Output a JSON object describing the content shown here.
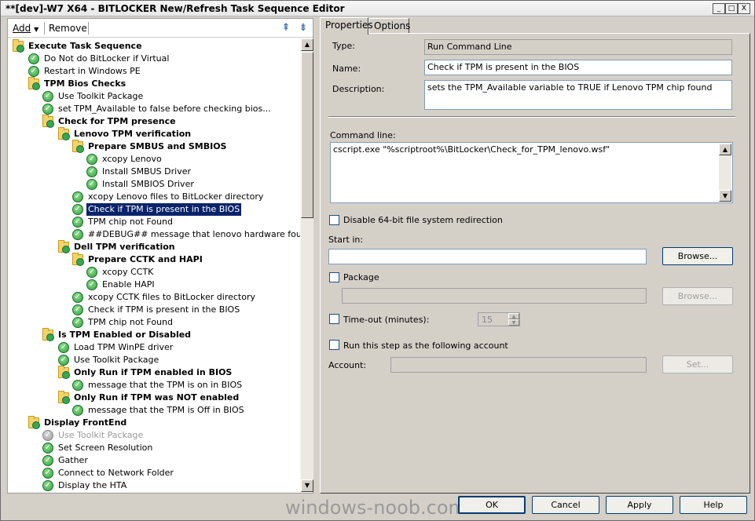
{
  "window": {
    "title": "**[dev]-W7 X64 - BITLOCKER New/Refresh Task Sequence Editor",
    "caption_buttons": [
      "_",
      "□",
      "X"
    ]
  },
  "toolbar": {
    "add_label": "Add",
    "remove_label": "Remove",
    "icons": [
      "move-up-icon",
      "move-down-icon"
    ]
  },
  "tree": {
    "items": [
      {
        "label": "Execute Task Sequence",
        "type": "group",
        "level": 0
      },
      {
        "label": "Do Not do BitLocker if Virtual",
        "type": "step",
        "level": 1
      },
      {
        "label": "Restart in Windows PE",
        "type": "step",
        "level": 1
      },
      {
        "label": "TPM Bios Checks",
        "type": "group",
        "level": 1
      },
      {
        "label": "Use Toolkit Package",
        "type": "step",
        "level": 2
      },
      {
        "label": "set TPM_Available to false before checking bios...",
        "type": "step",
        "level": 2
      },
      {
        "label": "Check for TPM presence",
        "type": "group",
        "level": 2
      },
      {
        "label": "Lenovo TPM verification",
        "type": "group",
        "level": 3
      },
      {
        "label": "Prepare SMBUS and SMBIOS",
        "type": "group",
        "level": 4
      },
      {
        "label": "xcopy Lenovo",
        "type": "step",
        "level": 5
      },
      {
        "label": "Install SMBUS Driver",
        "type": "step",
        "level": 5
      },
      {
        "label": "Install SMBIOS Driver",
        "type": "step",
        "level": 5
      },
      {
        "label": "xcopy Lenovo files to BitLocker directory",
        "type": "step",
        "level": 4
      },
      {
        "label": "Check if TPM is present in the BIOS",
        "type": "step",
        "level": 4,
        "selected": true
      },
      {
        "label": "TPM chip not Found",
        "type": "step",
        "level": 4
      },
      {
        "label": "##DEBUG## message that lenovo hardware found",
        "type": "step",
        "level": 4
      },
      {
        "label": "Dell TPM verification",
        "type": "group",
        "level": 3
      },
      {
        "label": "Prepare CCTK and HAPI",
        "type": "group",
        "level": 4
      },
      {
        "label": "xcopy CCTK",
        "type": "step",
        "level": 5
      },
      {
        "label": "Enable HAPI",
        "type": "step",
        "level": 5
      },
      {
        "label": "xcopy CCTK files to BitLocker directory",
        "type": "step",
        "level": 4
      },
      {
        "label": "Check if TPM is present in the BIOS",
        "type": "step",
        "level": 4
      },
      {
        "label": "TPM chip not Found",
        "type": "step",
        "level": 4
      },
      {
        "label": "Is TPM Enabled or Disabled",
        "type": "group",
        "level": 2
      },
      {
        "label": "Load TPM WinPE driver",
        "type": "step",
        "level": 3
      },
      {
        "label": "Use Toolkit Package",
        "type": "step",
        "level": 3
      },
      {
        "label": "Only Run if TPM enabled in BIOS",
        "type": "group",
        "level": 3
      },
      {
        "label": "message that the  TPM is on in BIOS",
        "type": "step",
        "level": 4
      },
      {
        "label": "Only Run if TPM was NOT enabled",
        "type": "group",
        "level": 3
      },
      {
        "label": "message that the  TPM is Off in BIOS",
        "type": "step",
        "level": 4
      },
      {
        "label": "Display FrontEnd",
        "type": "group",
        "level": 1
      },
      {
        "label": "Use Toolkit Package",
        "type": "step",
        "level": 2,
        "disabled": true
      },
      {
        "label": "Set Screen Resolution",
        "type": "step",
        "level": 2
      },
      {
        "label": "Gather",
        "type": "step",
        "level": 2
      },
      {
        "label": "Connect to Network Folder",
        "type": "step",
        "level": 2
      },
      {
        "label": "Display the HTA",
        "type": "step",
        "level": 2
      }
    ]
  },
  "tabs": [
    {
      "label": "Properties",
      "active": true
    },
    {
      "label": "Options",
      "active": false
    }
  ],
  "properties": {
    "type_label": "Type:",
    "type_value": "Run Command Line",
    "name_label": "Name:",
    "name_value": "Check if TPM is present in the BIOS",
    "description_label": "Description:",
    "description_value": "sets the TPM_Available variable to TRUE if Lenovo TPM chip found",
    "command_line_label": "Command line:",
    "command_line_value": "cscript.exe \"%scriptroot%\\BitLocker\\Check_for_TPM_lenovo.wsf\"",
    "disable_redirection_label": "Disable 64-bit file system redirection",
    "start_in_label": "Start in:",
    "start_in_value": "",
    "browse_label": "Browse...",
    "package_label": "Package",
    "package_value": "",
    "browse_package_label": "Browse...",
    "timeout_label": "Time-out (minutes):",
    "timeout_value": "15",
    "run_as_label": "Run this step as the following account",
    "account_label": "Account:",
    "account_value": "",
    "set_label": "Set..."
  },
  "footer": {
    "ok_label": "OK",
    "cancel_label": "Cancel",
    "apply_label": "Apply",
    "help_label": "Help",
    "watermark": "windows-noob.com"
  }
}
